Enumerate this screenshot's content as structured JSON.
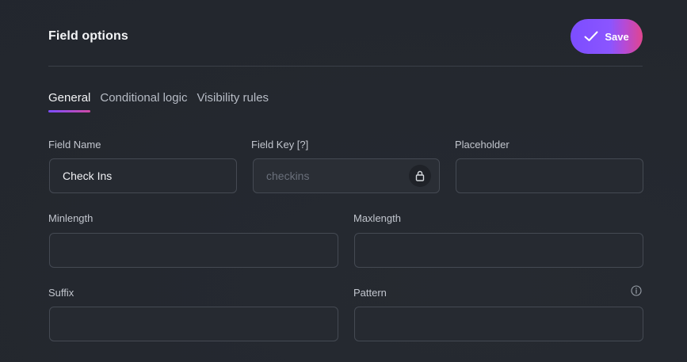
{
  "header": {
    "title": "Field options",
    "save_label": "Save"
  },
  "tabs": [
    {
      "label": "General",
      "active": true
    },
    {
      "label": "Conditional logic",
      "active": false
    },
    {
      "label": "Visibility rules",
      "active": false
    }
  ],
  "fields": {
    "field_name": {
      "label": "Field Name",
      "value": "Check Ins"
    },
    "field_key": {
      "label": "Field Key [?]",
      "placeholder": "checkins"
    },
    "placeholder": {
      "label": "Placeholder",
      "value": ""
    },
    "minlength": {
      "label": "Minlength",
      "value": ""
    },
    "maxlength": {
      "label": "Maxlength",
      "value": ""
    },
    "suffix": {
      "label": "Suffix",
      "value": ""
    },
    "pattern": {
      "label": "Pattern",
      "value": ""
    }
  },
  "icons": {
    "save": "check-icon",
    "field_key": "lock-icon",
    "pattern": "info-icon"
  },
  "colors": {
    "accent_start": "#7c4dff",
    "accent_end": "#e0458f",
    "background": "#24282f"
  }
}
